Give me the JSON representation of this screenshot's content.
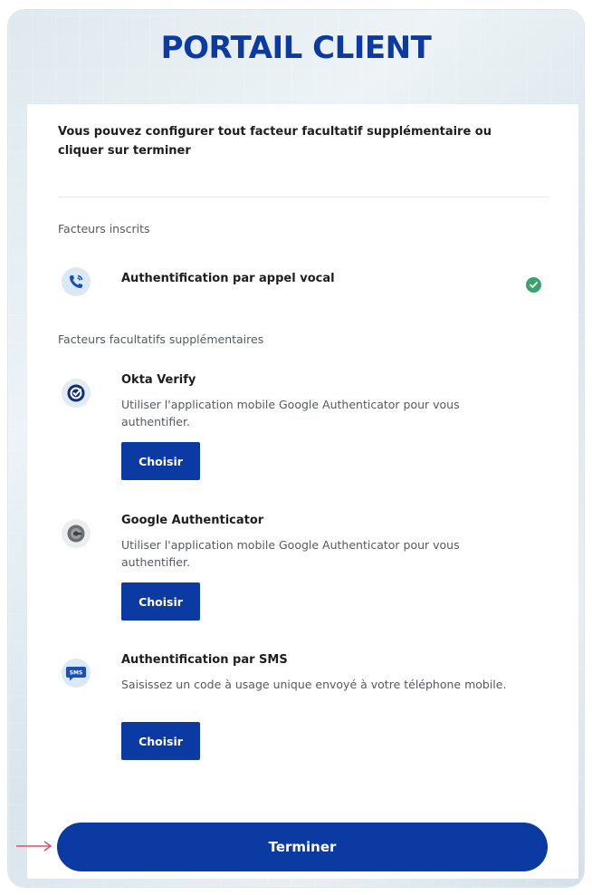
{
  "header": {
    "title": "PORTAIL CLIENT"
  },
  "intro": "Vous pouvez configurer tout facteur facultatif supplémentaire ou cliquer sur terminer",
  "enrolled": {
    "label": "Facteurs inscrits",
    "items": [
      {
        "title": "Authentification par appel vocal",
        "icon": "phone-call-icon",
        "status": "enrolled"
      }
    ]
  },
  "optional": {
    "label": "Facteurs facultatifs supplémentaires",
    "items": [
      {
        "title": "Okta Verify",
        "description": "Utiliser l'application mobile Google Authenticator pour vous authentifier.",
        "button": "Choisir",
        "icon": "okta-verify-icon"
      },
      {
        "title": "Google Authenticator",
        "description": "Utiliser l'application mobile Google Authenticator pour vous authentifier.",
        "button": "Choisir",
        "icon": "google-authenticator-icon"
      },
      {
        "title": "Authentification par SMS",
        "description": "Saisissez un code à usage unique envoyé à votre téléphone mobile.",
        "button": "Choisir",
        "icon": "sms-icon",
        "icon_text": "SMS"
      }
    ]
  },
  "finish_button": "Terminer",
  "colors": {
    "brand": "#0c3aa3",
    "success": "#3aa36a",
    "arrow": "#e0506a"
  }
}
